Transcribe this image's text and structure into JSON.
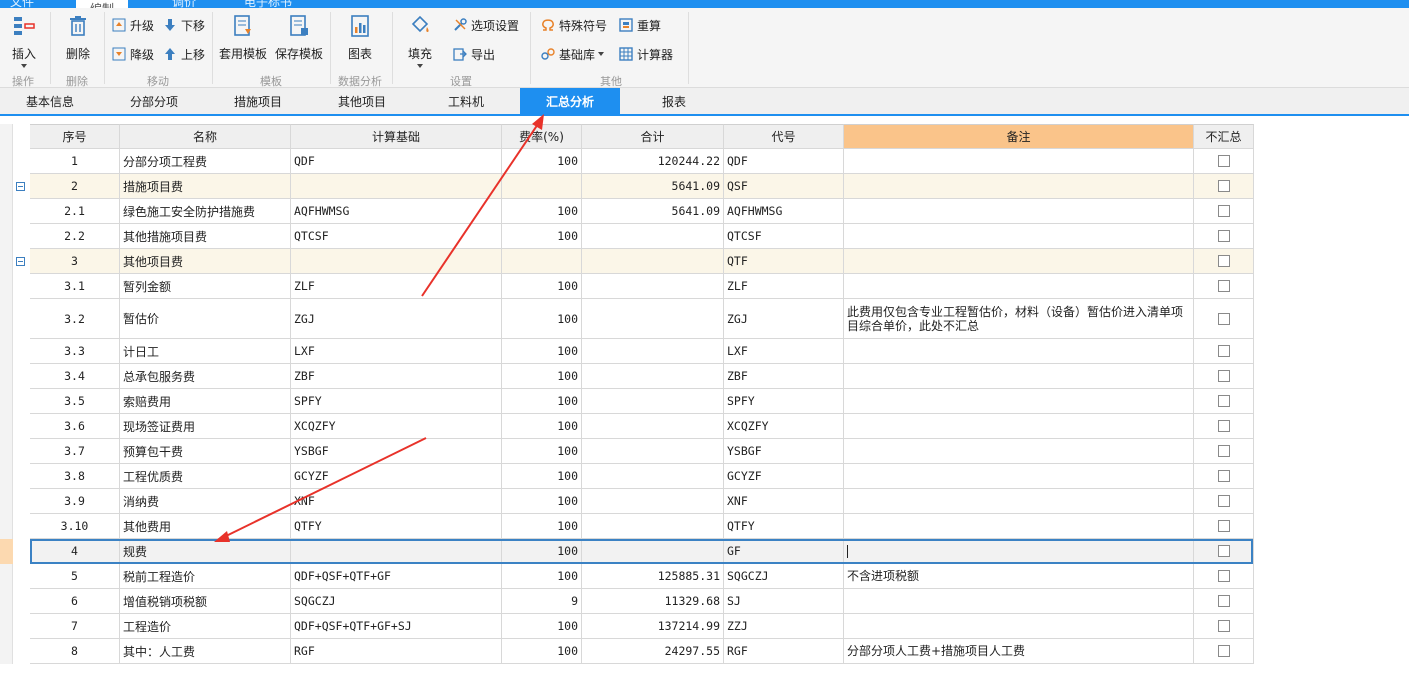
{
  "menu": [
    "文件",
    "编制",
    "调价",
    "电子标书"
  ],
  "ribbon": {
    "insert": "插入",
    "delete": "删除",
    "upgrade": "升级",
    "downgrade": "降级",
    "move_down": "下移",
    "move_up": "上移",
    "apply_template": "套用模板",
    "save_template": "保存模板",
    "chart": "图表",
    "fill": "填充",
    "options": "选项设置",
    "export": "导出",
    "special_symbol": "特殊符号",
    "recalc": "重算",
    "base_lib": "基础库",
    "calculator": "计算器",
    "groups": {
      "operate": "操作",
      "delete": "删除",
      "move": "移动",
      "template": "模板",
      "analysis": "数据分析",
      "settings": "设置",
      "other": "其他"
    }
  },
  "tabs": [
    "基本信息",
    "分部分项",
    "措施项目",
    "其他项目",
    "工料机",
    "汇总分析",
    "报表"
  ],
  "active_tab": "汇总分析",
  "columns": [
    "序号",
    "名称",
    "计算基础",
    "费率(%)",
    "合计",
    "代号",
    "备注",
    "不汇总"
  ],
  "rows": [
    {
      "no": "1",
      "name": "分部分项工程费",
      "base": "QDF",
      "rate": "100",
      "total": "120244.22",
      "code": "QDF",
      "note": ""
    },
    {
      "no": "2",
      "name": "措施项目费",
      "base": "",
      "rate": "",
      "total": "5641.09",
      "code": "QSF",
      "note": ""
    },
    {
      "no": "2.1",
      "name": "绿色施工安全防护措施费",
      "base": "AQFHWMSG",
      "rate": "100",
      "total": "5641.09",
      "code": "AQFHWMSG",
      "note": ""
    },
    {
      "no": "2.2",
      "name": "其他措施项目费",
      "base": "QTCSF",
      "rate": "100",
      "total": "",
      "code": "QTCSF",
      "note": ""
    },
    {
      "no": "3",
      "name": "其他项目费",
      "base": "",
      "rate": "",
      "total": "",
      "code": "QTF",
      "note": ""
    },
    {
      "no": "3.1",
      "name": "暂列金额",
      "base": "ZLF",
      "rate": "100",
      "total": "",
      "code": "ZLF",
      "note": ""
    },
    {
      "no": "3.2",
      "name": "暂估价",
      "base": "ZGJ",
      "rate": "100",
      "total": "",
      "code": "ZGJ",
      "note": "此费用仅包含专业工程暂估价，材料（设备）暂估价进入清单项目综合单价，此处不汇总"
    },
    {
      "no": "3.3",
      "name": "计日工",
      "base": "LXF",
      "rate": "100",
      "total": "",
      "code": "LXF",
      "note": ""
    },
    {
      "no": "3.4",
      "name": "总承包服务费",
      "base": "ZBF",
      "rate": "100",
      "total": "",
      "code": "ZBF",
      "note": ""
    },
    {
      "no": "3.5",
      "name": "索赔费用",
      "base": "SPFY",
      "rate": "100",
      "total": "",
      "code": "SPFY",
      "note": ""
    },
    {
      "no": "3.6",
      "name": "现场签证费用",
      "base": "XCQZFY",
      "rate": "100",
      "total": "",
      "code": "XCQZFY",
      "note": ""
    },
    {
      "no": "3.7",
      "name": "预算包干费",
      "base": "YSBGF",
      "rate": "100",
      "total": "",
      "code": "YSBGF",
      "note": ""
    },
    {
      "no": "3.8",
      "name": "工程优质费",
      "base": "GCYZF",
      "rate": "100",
      "total": "",
      "code": "GCYZF",
      "note": ""
    },
    {
      "no": "3.9",
      "name": "消纳费",
      "base": "XNF",
      "rate": "100",
      "total": "",
      "code": "XNF",
      "note": ""
    },
    {
      "no": "3.10",
      "name": "其他费用",
      "base": "QTFY",
      "rate": "100",
      "total": "",
      "code": "QTFY",
      "note": ""
    },
    {
      "no": "4",
      "name": "规费",
      "base": "",
      "rate": "100",
      "total": "",
      "code": "GF",
      "note": ""
    },
    {
      "no": "5",
      "name": "税前工程造价",
      "base": "QDF+QSF+QTF+GF",
      "rate": "100",
      "total": "125885.31",
      "code": "SQGCZJ",
      "note": "不含进项税额"
    },
    {
      "no": "6",
      "name": "增值税销项税额",
      "base": "SQGCZJ",
      "rate": "9",
      "total": "11329.68",
      "code": "SJ",
      "note": ""
    },
    {
      "no": "7",
      "name": "工程造价",
      "base": "QDF+QSF+QTF+GF+SJ",
      "rate": "100",
      "total": "137214.99",
      "code": "ZZJ",
      "note": ""
    },
    {
      "no": "8",
      "name": "其中：人工费",
      "base": "RGF",
      "rate": "100",
      "total": "24297.55",
      "code": "RGF",
      "note": "分部分项人工费+措施项目人工费"
    }
  ],
  "colors": {
    "accent": "#1e8ff0",
    "annotation_arrow": "#e8322a",
    "note_header": "#fac48a"
  }
}
